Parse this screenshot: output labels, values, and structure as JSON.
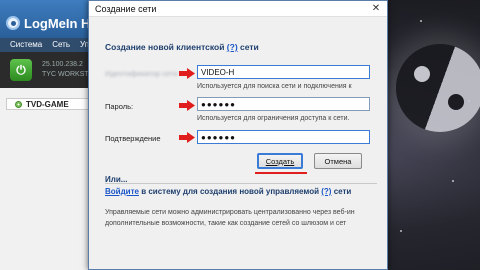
{
  "hamachi": {
    "title": "LogMeIn Han",
    "menu": [
      "Система",
      "Сеть",
      "Упр"
    ],
    "ip_line1": "25.100.238.2",
    "ip_line2": "TYC WORKSTAT",
    "network_name": "TVD-GAME"
  },
  "dialog": {
    "title": "Создание сети",
    "close_label": "✕",
    "heading_text": "Создание новой клиентской",
    "heading_help": "(?)",
    "heading_suffix": "сети",
    "network_id_label": "Идентификатор сети",
    "network_id_value": "VIDEO-H",
    "network_id_hint": "Используется для поиска сети и подключения к",
    "password_label": "Пароль:",
    "password_value": "●●●●●●",
    "password_hint": "Используется для ограничения доступа к сети.",
    "confirm_label": "Подтверждение",
    "confirm_value": "●●●●●●",
    "create_button": "Создать",
    "cancel_button": "Отмена",
    "or_text": "Или...",
    "login_link": "Войдите",
    "login_rest": "в систему для создания новой управляемой",
    "login_help": "(?)",
    "login_suffix": "сети",
    "desc_line1": "Управляемые сети можно администрировать централизованно через веб-ин",
    "desc_line2": "дополнительные возможности, такие как создание сетей со шлюзом и сет"
  },
  "colors": {
    "accent_blue": "#3a7bd5",
    "arrow_red": "#e01e1e",
    "link_blue": "#1a56c8",
    "heading_navy": "#1e3f6e"
  }
}
